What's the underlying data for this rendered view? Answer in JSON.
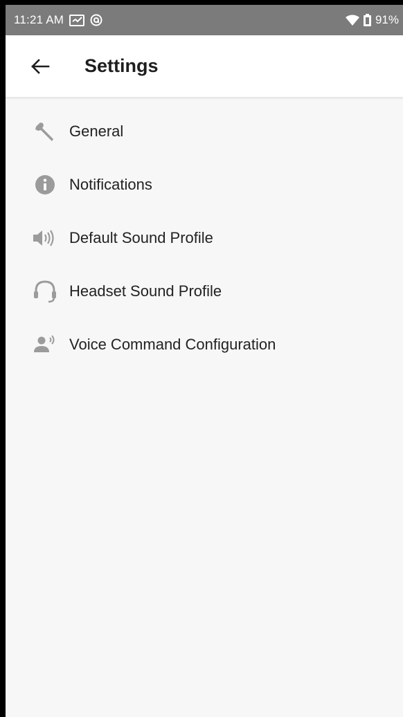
{
  "status_bar": {
    "time": "11:21 AM",
    "battery": "91%",
    "icons": [
      "message-icon",
      "sync-icon",
      "wifi-icon",
      "battery-icon"
    ]
  },
  "app_bar": {
    "title": "Settings",
    "back_icon": "arrow-back-icon"
  },
  "settings": {
    "items": [
      {
        "label": "General",
        "icon": "wrench-icon"
      },
      {
        "label": "Notifications",
        "icon": "info-icon"
      },
      {
        "label": "Default Sound Profile",
        "icon": "speaker-icon"
      },
      {
        "label": "Headset Sound Profile",
        "icon": "headset-icon"
      },
      {
        "label": "Voice Command Configuration",
        "icon": "voice-command-icon"
      }
    ]
  },
  "colors": {
    "status_bar": "#7b7b7b",
    "icon_gray": "#9b9b9b",
    "text": "#222222",
    "background": "#f7f7f7"
  }
}
